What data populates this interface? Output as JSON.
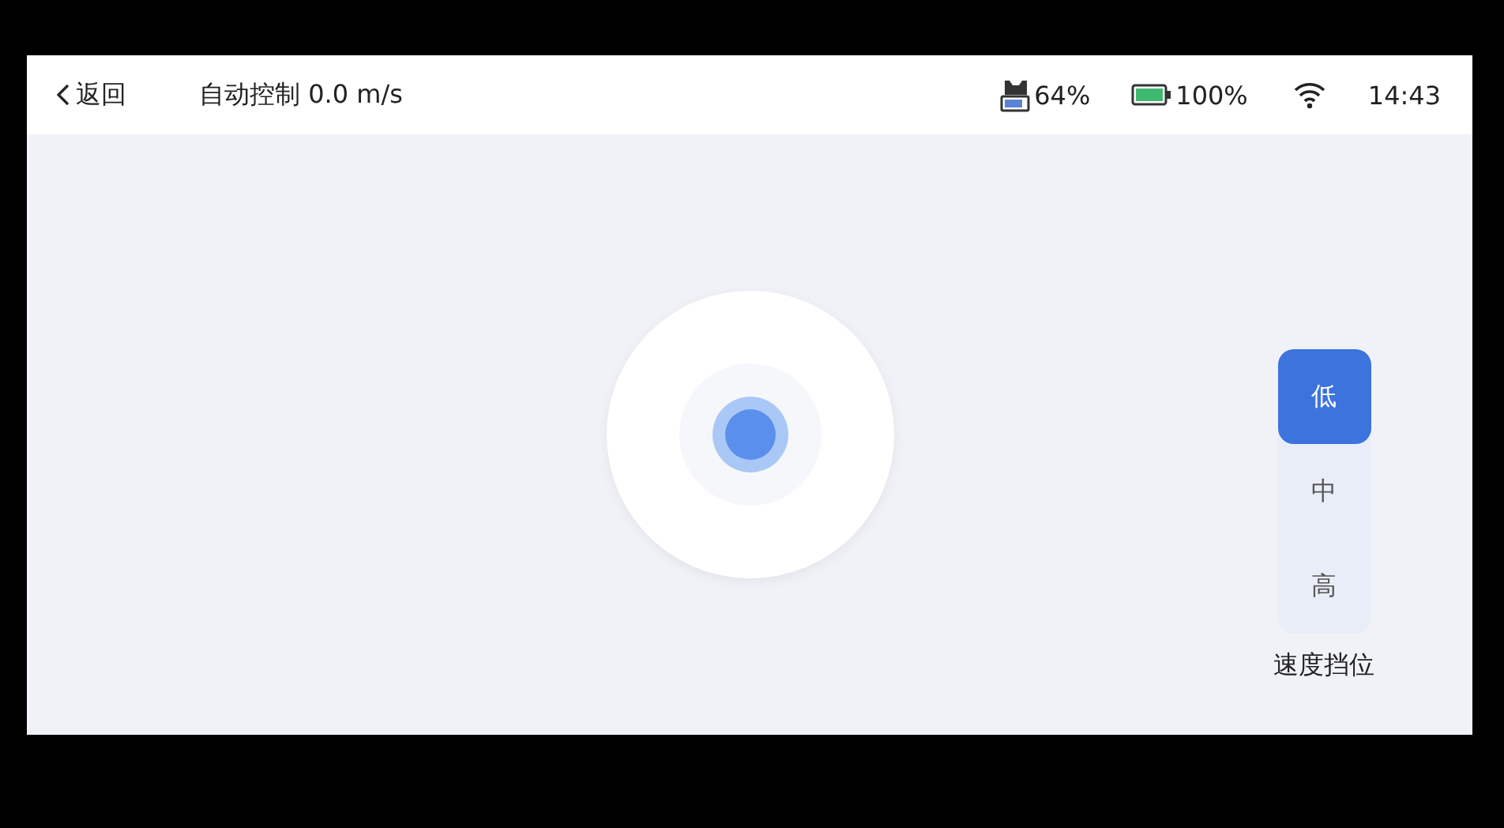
{
  "header": {
    "back": "返回",
    "title": "自动控制 0.0 m/s",
    "vehicle_battery": "64%",
    "device_battery": "100%",
    "time": "14:43"
  },
  "speed_gears": {
    "label": "速度挡位",
    "options": [
      {
        "label": "低",
        "selected": true
      },
      {
        "label": "中",
        "selected": false
      },
      {
        "label": "高",
        "selected": false
      }
    ]
  }
}
